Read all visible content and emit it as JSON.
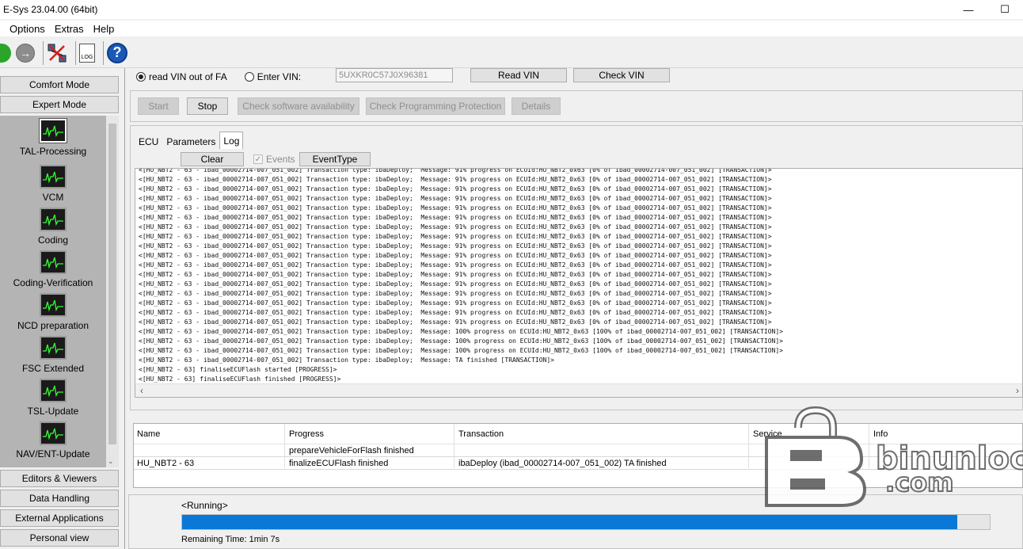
{
  "window": {
    "title": "E-Sys 23.04.00  (64bit)"
  },
  "menu": [
    "Options",
    "Extras",
    "Help"
  ],
  "toolbar": {
    "icons": [
      "connect-icon",
      "disconnect-icon",
      "network-icon",
      "log-icon",
      "help-icon"
    ],
    "log_label": "LOG",
    "help_label": "?"
  },
  "sidebar": {
    "comfort_mode": "Comfort Mode",
    "expert_mode": "Expert Mode",
    "items": [
      {
        "label": "TAL-Processing",
        "selected": true
      },
      {
        "label": "VCM"
      },
      {
        "label": "Coding"
      },
      {
        "label": "Coding-Verification"
      },
      {
        "label": "NCD preparation"
      },
      {
        "label": "FSC Extended"
      },
      {
        "label": "TSL-Update"
      },
      {
        "label": "NAV/ENT-Update"
      }
    ],
    "bottom": [
      "Editors & Viewers",
      "Data Handling",
      "External Applications",
      "Personal view"
    ]
  },
  "vin": {
    "read_from_fa": "read VIN out of FA",
    "enter_vin": "Enter VIN:",
    "value": "5UXKR0C57J0X96381",
    "read_btn": "Read VIN",
    "check_btn": "Check VIN"
  },
  "actions": {
    "start": "Start",
    "stop": "Stop",
    "check_sw": "Check software availability",
    "check_prog": "Check Programming Protection",
    "details": "Details"
  },
  "tabs": [
    "ECU",
    "Parameters",
    "Log"
  ],
  "log_toolbar": {
    "clear": "Clear",
    "events": "Events",
    "event_type": "EventType"
  },
  "log_lines": [
    "<[HU_NBT2 - 63 - ibad_00002714-007_051_002] Transaction type: ibaDeploy;  Message: 91% progress on ECUId:HU_NBT2_0x63 [0% of ibad_00002714-007_051_002] [TRANSACTION]>",
    "<[HU_NBT2 - 63 - ibad_00002714-007_051_002] Transaction type: ibaDeploy;  Message: 91% progress on ECUId:HU_NBT2_0x63 [0% of ibad_00002714-007_051_002] [TRANSACTION]>",
    "<[HU_NBT2 - 63 - ibad_00002714-007_051_002] Transaction type: ibaDeploy;  Message: 91% progress on ECUId:HU_NBT2_0x63 [0% of ibad_00002714-007_051_002] [TRANSACTION]>",
    "<[HU_NBT2 - 63 - ibad_00002714-007_051_002] Transaction type: ibaDeploy;  Message: 91% progress on ECUId:HU_NBT2_0x63 [0% of ibad_00002714-007_051_002] [TRANSACTION]>",
    "<[HU_NBT2 - 63 - ibad_00002714-007_051_002] Transaction type: ibaDeploy;  Message: 91% progress on ECUId:HU_NBT2_0x63 [0% of ibad_00002714-007_051_002] [TRANSACTION]>",
    "<[HU_NBT2 - 63 - ibad_00002714-007_051_002] Transaction type: ibaDeploy;  Message: 91% progress on ECUId:HU_NBT2_0x63 [0% of ibad_00002714-007_051_002] [TRANSACTION]>",
    "<[HU_NBT2 - 63 - ibad_00002714-007_051_002] Transaction type: ibaDeploy;  Message: 91% progress on ECUId:HU_NBT2_0x63 [0% of ibad_00002714-007_051_002] [TRANSACTION]>",
    "<[HU_NBT2 - 63 - ibad_00002714-007_051_002] Transaction type: ibaDeploy;  Message: 91% progress on ECUId:HU_NBT2_0x63 [0% of ibad_00002714-007_051_002] [TRANSACTION]>",
    "<[HU_NBT2 - 63 - ibad_00002714-007_051_002] Transaction type: ibaDeploy;  Message: 91% progress on ECUId:HU_NBT2_0x63 [0% of ibad_00002714-007_051_002] [TRANSACTION]>",
    "<[HU_NBT2 - 63 - ibad_00002714-007_051_002] Transaction type: ibaDeploy;  Message: 91% progress on ECUId:HU_NBT2_0x63 [0% of ibad_00002714-007_051_002] [TRANSACTION]>",
    "<[HU_NBT2 - 63 - ibad_00002714-007_051_002] Transaction type: ibaDeploy;  Message: 91% progress on ECUId:HU_NBT2_0x63 [0% of ibad_00002714-007_051_002] [TRANSACTION]>",
    "<[HU_NBT2 - 63 - ibad_00002714-007_051_002] Transaction type: ibaDeploy;  Message: 91% progress on ECUId:HU_NBT2_0x63 [0% of ibad_00002714-007_051_002] [TRANSACTION]>",
    "<[HU_NBT2 - 63 - ibad_00002714-007_051_002] Transaction type: ibaDeploy;  Message: 91% progress on ECUId:HU_NBT2_0x63 [0% of ibad_00002714-007_051_002] [TRANSACTION]>",
    "<[HU_NBT2 - 63 - ibad_00002714-007_051_002] Transaction type: ibaDeploy;  Message: 91% progress on ECUId:HU_NBT2_0x63 [0% of ibad_00002714-007_051_002] [TRANSACTION]>",
    "<[HU_NBT2 - 63 - ibad_00002714-007_051_002] Transaction type: ibaDeploy;  Message: 91% progress on ECUId:HU_NBT2_0x63 [0% of ibad_00002714-007_051_002] [TRANSACTION]>",
    "<[HU_NBT2 - 63 - ibad_00002714-007_051_002] Transaction type: ibaDeploy;  Message: 91% progress on ECUId:HU_NBT2_0x63 [0% of ibad_00002714-007_051_002] [TRANSACTION]>",
    "<[HU_NBT2 - 63 - ibad_00002714-007_051_002] Transaction type: ibaDeploy;  Message: 91% progress on ECUId:HU_NBT2_0x63 [0% of ibad_00002714-007_051_002] [TRANSACTION]>",
    "<[HU_NBT2 - 63 - ibad_00002714-007_051_002] Transaction type: ibaDeploy;  Message: 100% progress on ECUId:HU_NBT2_0x63 [100% of ibad_00002714-007_051_002] [TRANSACTION]>",
    "<[HU_NBT2 - 63 - ibad_00002714-007_051_002] Transaction type: ibaDeploy;  Message: 100% progress on ECUId:HU_NBT2_0x63 [100% of ibad_00002714-007_051_002] [TRANSACTION]>",
    "<[HU_NBT2 - 63 - ibad_00002714-007_051_002] Transaction type: ibaDeploy;  Message: 100% progress on ECUId:HU_NBT2_0x63 [100% of ibad_00002714-007_051_002] [TRANSACTION]>",
    "<[HU_NBT2 - 63 - ibad_00002714-007_051_002] Transaction type: ibaDeploy;  Message: TA finished [TRANSACTION]>",
    "<[HU_NBT2 - 63] finaliseECUFlash started [PROGRESS]>",
    "<[HU_NBT2 - 63] finaliseECUFlash finished [PROGRESS]>"
  ],
  "results": {
    "headers": [
      "Name",
      "Progress",
      "Transaction",
      "Service",
      "Info"
    ],
    "rows": [
      [
        "",
        "prepareVehicleForFlash finished",
        "",
        "",
        ""
      ],
      [
        "HU_NBT2 - 63",
        "finalizeECUFlash finished",
        "ibaDeploy (ibad_00002714-007_051_002) TA finished",
        "",
        ""
      ]
    ]
  },
  "status": {
    "running": "<Running>",
    "progress_fraction": 0.96,
    "remaining_label": "Remaining Time:",
    "remaining_value": "1min 7s"
  },
  "watermark": {
    "line1": "binunlock",
    "line2": ".com"
  },
  "colors": {
    "progress": "#0a78d7",
    "accent": "#1b58b8"
  }
}
